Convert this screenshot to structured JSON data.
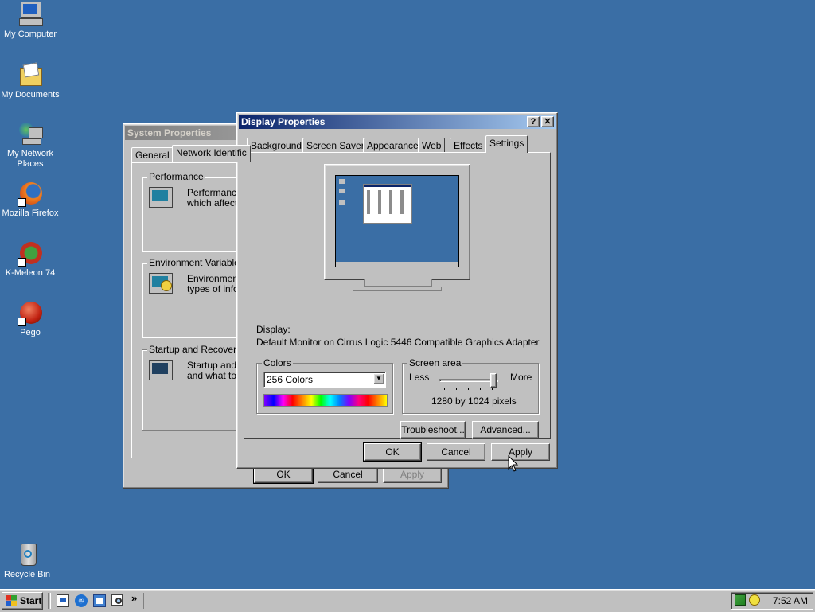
{
  "desktop": {
    "icons": [
      {
        "label": "My Computer",
        "icon": "my-computer-icon"
      },
      {
        "label": "My Documents",
        "icon": "my-documents-icon"
      },
      {
        "label": "My Network Places",
        "icon": "network-places-icon"
      },
      {
        "label": "Mozilla Firefox",
        "icon": "firefox-icon"
      },
      {
        "label": "K-Meleon 74",
        "icon": "kmeleon-icon"
      },
      {
        "label": "Pego",
        "icon": "pego-icon"
      },
      {
        "label": "Recycle Bin",
        "icon": "recycle-bin-icon"
      }
    ]
  },
  "system_properties": {
    "title": "System Properties",
    "tabs": [
      "General",
      "Network Identific"
    ],
    "performance": {
      "legend": "Performance",
      "text1": "Performance",
      "text2": "which affects"
    },
    "environment": {
      "legend": "Environment Variables",
      "text1": "Environment",
      "text2": "types of infor"
    },
    "startup": {
      "legend": "Startup and Recovery",
      "text1": "Startup and r",
      "text2": "and what to d"
    },
    "buttons": {
      "ok": "OK",
      "cancel": "Cancel",
      "apply": "Apply"
    }
  },
  "display_properties": {
    "title": "Display Properties",
    "help_btn": "?",
    "close_btn": "✕",
    "tabs": [
      "Background",
      "Screen Saver",
      "Appearance",
      "Web",
      "Effects",
      "Settings"
    ],
    "selected_tab": "Settings",
    "display_label": "Display:",
    "display_value": "Default Monitor on Cirrus Logic 5446 Compatible Graphics Adapter",
    "colors": {
      "legend": "Colors",
      "selected": "256 Colors"
    },
    "screen_area": {
      "legend": "Screen area",
      "less": "Less",
      "more": "More",
      "resolution": "1280 by 1024 pixels",
      "slider_fraction": 1.0
    },
    "troubleshoot_btn": "Troubleshoot...",
    "advanced_btn": "Advanced...",
    "ok_btn": "OK",
    "cancel_btn": "Cancel",
    "apply_btn": "Apply"
  },
  "taskbar": {
    "start_label": "Start",
    "quicklaunch": [
      "show-desktop-icon",
      "ie-icon",
      "outlook-icon",
      "search-icon"
    ],
    "chevron": "»",
    "clock": "7:52 AM"
  },
  "colors": {
    "desktop": "#3a6ea5",
    "title_active": "#0a246a",
    "face": "#c0c0c0"
  }
}
